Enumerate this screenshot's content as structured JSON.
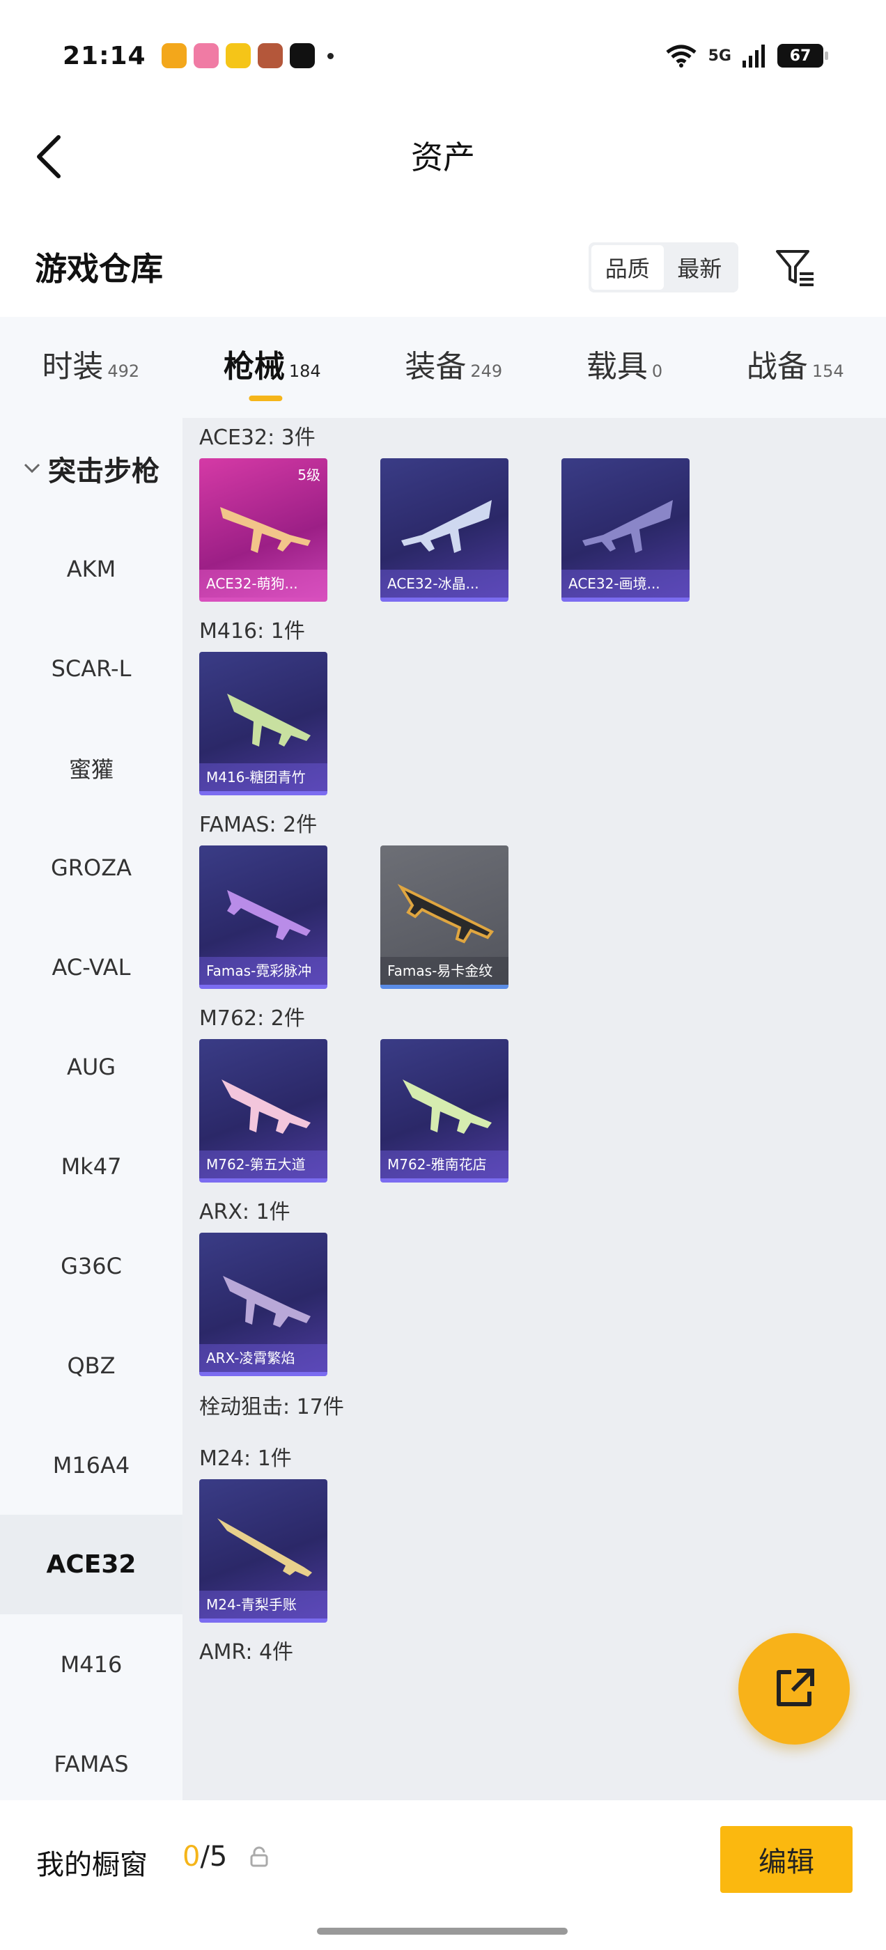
{
  "status_bar": {
    "time": "21:14",
    "network": "5G",
    "battery": "67"
  },
  "header": {
    "title": "资产"
  },
  "warehouse": {
    "title": "游戏仓库",
    "sort_options": [
      "品质",
      "最新"
    ]
  },
  "tabs": [
    {
      "label": "时装",
      "count": "492"
    },
    {
      "label": "枪械",
      "count": "184"
    },
    {
      "label": "装备",
      "count": "249"
    },
    {
      "label": "载具",
      "count": "0"
    },
    {
      "label": "战备",
      "count": "154"
    }
  ],
  "active_tab": "枪械",
  "sidebar": {
    "group": "突击步枪",
    "items": [
      "AKM",
      "SCAR-L",
      "蜜獾",
      "GROZA",
      "AC-VAL",
      "AUG",
      "Mk47",
      "G36C",
      "QBZ",
      "M16A4",
      "ACE32",
      "M416",
      "FAMAS"
    ],
    "active": "ACE32"
  },
  "sections": [
    {
      "title": "ACE32: 3件",
      "items": [
        {
          "label": "ACE32-萌狗...",
          "level": "5级",
          "style": "pink"
        },
        {
          "label": "ACE32-冰晶...",
          "style": "purple"
        },
        {
          "label": "ACE32-画境...",
          "style": "purple"
        }
      ]
    },
    {
      "title": "M416: 1件",
      "items": [
        {
          "label": "M416-糖团青竹",
          "style": "purple"
        }
      ]
    },
    {
      "title": "FAMAS: 2件",
      "items": [
        {
          "label": "Famas-霓彩脉冲",
          "style": "purple"
        },
        {
          "label": "Famas-易卡金纹",
          "style": "gray"
        }
      ]
    },
    {
      "title": "M762: 2件",
      "items": [
        {
          "label": "M762-第五大道",
          "style": "purple"
        },
        {
          "label": "M762-雅南花店",
          "style": "purple"
        }
      ]
    },
    {
      "title": "ARX: 1件",
      "items": [
        {
          "label": "ARX-凌霄繁焰",
          "style": "purple"
        }
      ]
    },
    {
      "title": "栓动狙击: 17件",
      "items": []
    },
    {
      "title": "M24: 1件",
      "items": [
        {
          "label": "M24-青梨手账",
          "style": "purple"
        }
      ]
    },
    {
      "title": "AMR: 4件",
      "items": []
    }
  ],
  "showcase": {
    "label": "我的橱窗",
    "current": "0",
    "total": "/5"
  },
  "edit_button": "编辑",
  "colors": {
    "accent": "#f5b51a",
    "card_purple": "#2b2868",
    "card_pink": "#c22a9e"
  }
}
